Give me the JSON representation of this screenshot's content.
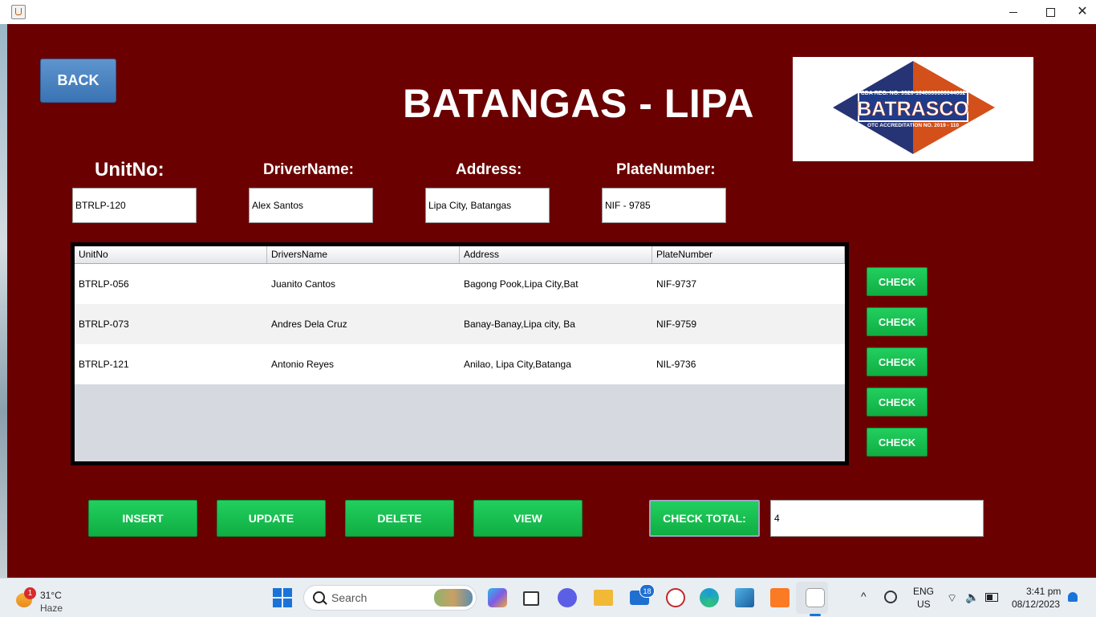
{
  "window": {
    "controls": {
      "minimize": "minimize",
      "maximize": "maximize",
      "close": "✕"
    }
  },
  "app": {
    "back_label": "BACK",
    "route_title": "BATANGAS - LIPA",
    "logo": {
      "text": "BATRASCO",
      "reg_line": "CDA REG. NO. 9520-1040000000044662",
      "accreditation": "OTC ACCREDITATION NO. 2019 - 110",
      "colors": {
        "left": "#263476",
        "right": "#d3501a",
        "center": "#1f3c8c"
      }
    },
    "fields": [
      {
        "label": "UnitNo:",
        "value": "BTRLP-120"
      },
      {
        "label": "DriverName:",
        "value": "Alex Santos"
      },
      {
        "label": "Address:",
        "value": "Lipa City, Batangas"
      },
      {
        "label": "PlateNumber:",
        "value": "NIF - 9785"
      }
    ],
    "table": {
      "columns": [
        "UnitNo",
        "DriversName",
        "Address",
        "PlateNumber"
      ],
      "rows": [
        [
          "BTRLP-056",
          "Juanito Cantos",
          "Bagong Pook,Lipa City,Bat",
          "NIF-9737"
        ],
        [
          "BTRLP-073",
          "Andres Dela Cruz",
          "Banay-Banay,Lipa city, Ba",
          "NIF-9759"
        ],
        [
          "BTRLP-121",
          "Antonio Reyes",
          "Anilao, Lipa City,Batanga",
          "NIL-9736"
        ]
      ]
    },
    "check_buttons": [
      "CHECK",
      "CHECK",
      "CHECK",
      "CHECK",
      "CHECK"
    ],
    "actions": {
      "insert": "INSERT",
      "update": "UPDATE",
      "delete": "DELETE",
      "view": "VIEW"
    },
    "check_total": {
      "label": "CHECK TOTAL:",
      "value": "4"
    },
    "colors": {
      "background": "#6b0000",
      "button_green": "#14bb4d",
      "back_blue": "#4a84c4"
    }
  },
  "taskbar": {
    "weather": {
      "badge": "1",
      "temp": "31°C",
      "condition": "Haze"
    },
    "search_placeholder": "Search",
    "mail_badge": "18",
    "tray": {
      "chevron": "^",
      "lang_line1": "ENG",
      "lang_line2": "US",
      "time": "3:41 pm",
      "date": "08/12/2023"
    },
    "icons": [
      "windows-start-icon",
      "copilot-icon",
      "task-view-icon",
      "chat-icon",
      "file-explorer-icon",
      "mail-icon",
      "shield-app-icon",
      "edge-icon",
      "virtualbox-icon",
      "xampp-icon",
      "java-icon"
    ]
  }
}
